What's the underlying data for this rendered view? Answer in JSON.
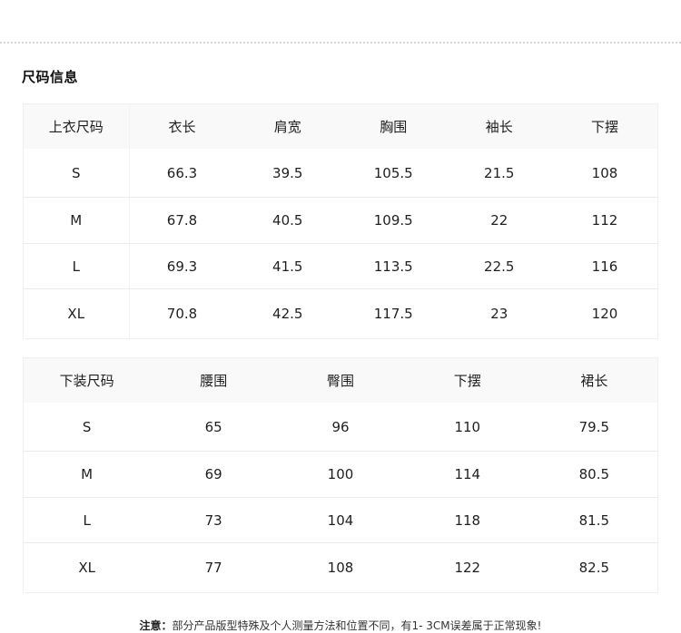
{
  "section_title": "尺码信息",
  "top_table": {
    "headers": [
      "上衣尺码",
      "衣长",
      "肩宽",
      "胸围",
      "袖长",
      "下摆"
    ],
    "rows": [
      [
        "S",
        "66.3",
        "39.5",
        "105.5",
        "21.5",
        "108"
      ],
      [
        "M",
        "67.8",
        "40.5",
        "109.5",
        "22",
        "112"
      ],
      [
        "L",
        "69.3",
        "41.5",
        "113.5",
        "22.5",
        "116"
      ],
      [
        "XL",
        "70.8",
        "42.5",
        "117.5",
        "23",
        "120"
      ]
    ]
  },
  "bottom_table": {
    "headers": [
      "下装尺码",
      "腰围",
      "臀围",
      "下摆",
      "裙长"
    ],
    "rows": [
      [
        "S",
        "65",
        "96",
        "110",
        "79.5"
      ],
      [
        "M",
        "69",
        "100",
        "114",
        "80.5"
      ],
      [
        "L",
        "73",
        "104",
        "118",
        "81.5"
      ],
      [
        "XL",
        "77",
        "108",
        "122",
        "82.5"
      ]
    ]
  },
  "note": {
    "label": "注意：",
    "text": "部分产品版型特殊及个人测量方法和位置不同，有1- 3CM误差属于正常现象!"
  }
}
